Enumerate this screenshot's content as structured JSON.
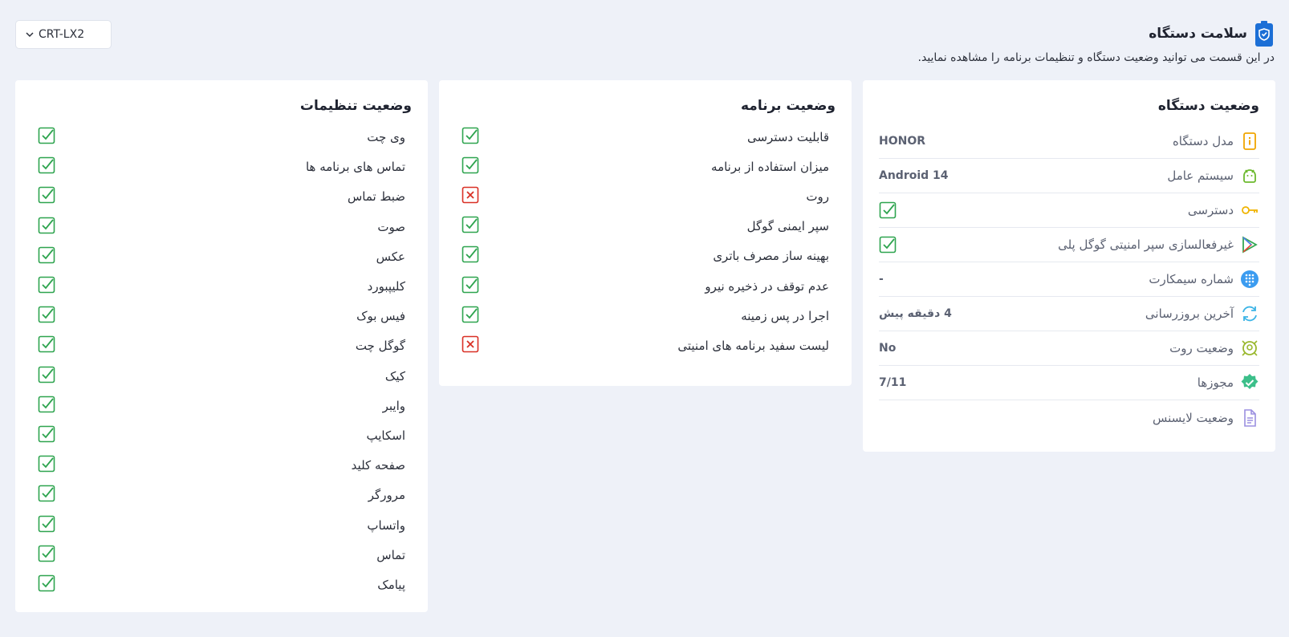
{
  "header": {
    "title": "سلامت دستگاه",
    "subtitle": "در این قسمت می توانید وضعیت دستگاه و تنظیمات برنامه را مشاهده نمایید."
  },
  "device_select": {
    "value": "CRT-LX2"
  },
  "device_status": {
    "title": "وضعیت دستگاه",
    "rows": [
      {
        "label": "مدل دستگاه",
        "value": "HONOR",
        "icon": "phone-info-icon"
      },
      {
        "label": "سیستم عامل",
        "value": "Android 14",
        "icon": "android-icon"
      },
      {
        "label": "دسترسی",
        "value": "",
        "icon": "key-icon",
        "check": true
      },
      {
        "label": "غیرفعالسازی سپر امنیتی گوگل پلی",
        "value": "",
        "icon": "google-play-icon",
        "check": true
      },
      {
        "label": "شماره سیمکارت",
        "value": "-",
        "icon": "dialpad-icon"
      },
      {
        "label": "آخرین بروزرسانی",
        "value": "4 دقیقه پیش",
        "icon": "sync-icon"
      },
      {
        "label": "وضعیت روت",
        "value": "No",
        "icon": "root-shield-icon"
      },
      {
        "label": "مجوزها",
        "value": "7/11",
        "icon": "verified-badge-icon"
      },
      {
        "label": "وضعیت لایسنس",
        "value": "",
        "icon": "document-icon"
      }
    ]
  },
  "app_status": {
    "title": "وضعیت برنامه",
    "items": [
      {
        "label": "قابلیت دسترسی",
        "ok": true
      },
      {
        "label": "میزان استفاده از برنامه",
        "ok": true
      },
      {
        "label": "روت",
        "ok": false
      },
      {
        "label": "سپر ایمنی گوگل",
        "ok": true
      },
      {
        "label": "بهینه ساز مصرف باتری",
        "ok": true
      },
      {
        "label": "عدم توقف در ذخیره نیرو",
        "ok": true
      },
      {
        "label": "اجرا در پس زمینه",
        "ok": true
      },
      {
        "label": "لیست سفید برنامه های امنیتی",
        "ok": false
      }
    ]
  },
  "settings_status": {
    "title": "وضعیت تنظیمات",
    "items": [
      {
        "label": "وی چت",
        "ok": true
      },
      {
        "label": "تماس های برنامه ها",
        "ok": true
      },
      {
        "label": "ضبط تماس",
        "ok": true
      },
      {
        "label": "صوت",
        "ok": true
      },
      {
        "label": "عکس",
        "ok": true
      },
      {
        "label": "کلیپبورد",
        "ok": true
      },
      {
        "label": "فیس بوک",
        "ok": true
      },
      {
        "label": "گوگل چت",
        "ok": true
      },
      {
        "label": "کیک",
        "ok": true
      },
      {
        "label": "وایبر",
        "ok": true
      },
      {
        "label": "اسکایپ",
        "ok": true
      },
      {
        "label": "صفحه کلید",
        "ok": true
      },
      {
        "label": "مرورگر",
        "ok": true
      },
      {
        "label": "واتساپ",
        "ok": true
      },
      {
        "label": "تماس",
        "ok": true
      },
      {
        "label": "پیامک",
        "ok": true
      }
    ]
  },
  "colors": {
    "ok": "#2ea44f",
    "fail": "#d93025",
    "background": "#eef1f8"
  }
}
